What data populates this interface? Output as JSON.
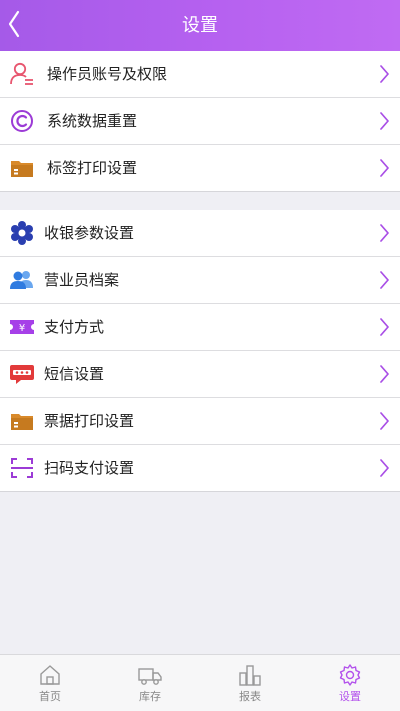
{
  "header": {
    "title": "设置"
  },
  "group1": [
    {
      "label": "操作员账号及权限",
      "icon": "operator-account-icon",
      "color": "#e8566f"
    },
    {
      "label": "系统数据重置",
      "icon": "reset-copyright-icon",
      "color": "#9c3bd6"
    },
    {
      "label": "标签打印设置",
      "icon": "folder-icon",
      "color": "#d98a2b"
    }
  ],
  "group2": [
    {
      "label": "收银参数设置",
      "icon": "gear-flower-icon",
      "color": "#2a3fb0"
    },
    {
      "label": "营业员档案",
      "icon": "people-icon",
      "color": "#2f7be0"
    },
    {
      "label": "支付方式",
      "icon": "ticket-yen-icon",
      "color": "#a640e8"
    },
    {
      "label": "短信设置",
      "icon": "chat-bubble-icon",
      "color": "#e23a3a"
    },
    {
      "label": "票据打印设置",
      "icon": "folder-icon",
      "color": "#d98a2b"
    },
    {
      "label": "扫码支付设置",
      "icon": "scan-icon",
      "color": "#9c3bd6"
    }
  ],
  "tabs": [
    {
      "label": "首页",
      "icon": "home-icon",
      "active": false
    },
    {
      "label": "库存",
      "icon": "truck-icon",
      "active": false
    },
    {
      "label": "报表",
      "icon": "report-icon",
      "active": false
    },
    {
      "label": "设置",
      "icon": "settings-gear-icon",
      "active": true
    }
  ],
  "colors": {
    "header": "#b05eee",
    "accent": "#b352ec",
    "chevron": "#a94ee6"
  }
}
